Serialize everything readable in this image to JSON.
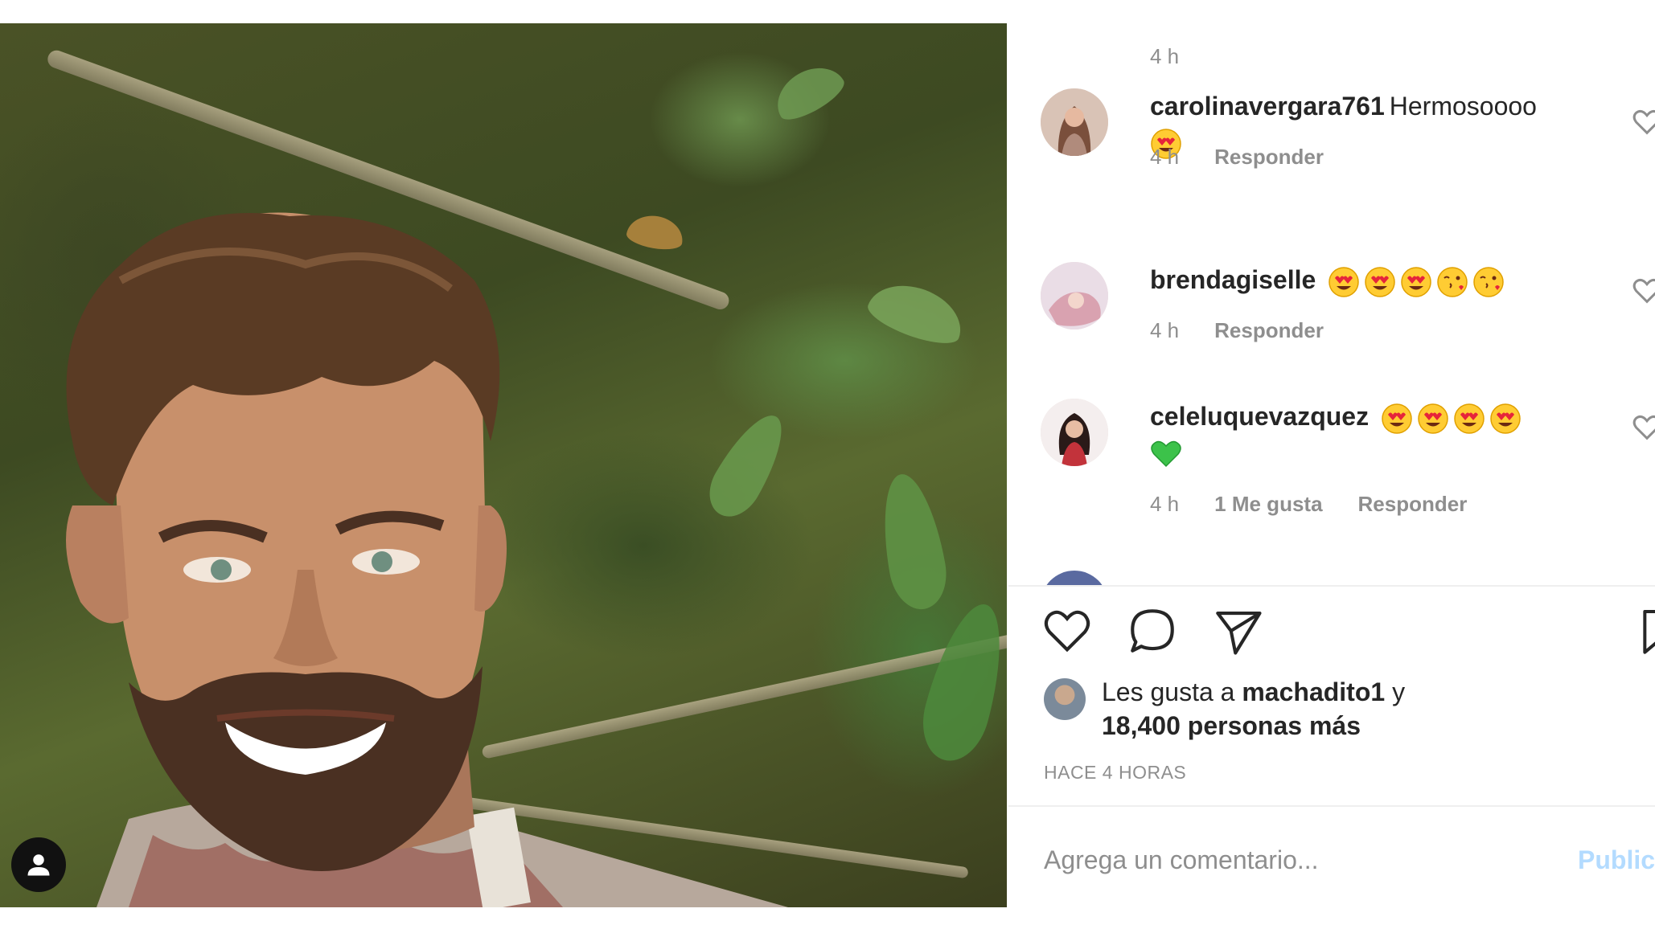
{
  "post": {
    "time_top": "4 h",
    "comments": [
      {
        "username": "carolinavergara761",
        "text": "Hermosoooo",
        "emojis": [
          "heart-eyes-emoji"
        ],
        "time": "4 h",
        "likes": "",
        "reply": "Responder"
      },
      {
        "username": "brendagiselle",
        "text": "",
        "emojis": [
          "heart-eyes-emoji",
          "heart-eyes-emoji",
          "heart-eyes-emoji",
          "kissing-emoji",
          "kissing-emoji"
        ],
        "time": "4 h",
        "likes": "",
        "reply": "Responder"
      },
      {
        "username": "celeluquevazquez",
        "text": "",
        "emojis": [
          "heart-eyes-emoji",
          "heart-eyes-emoji",
          "heart-eyes-emoji",
          "heart-eyes-emoji",
          "green-heart-emoji"
        ],
        "time": "4 h",
        "likes": "1 Me gusta",
        "reply": "Responder"
      }
    ],
    "actions": [
      "heart-icon",
      "comment-icon",
      "share-icon",
      "bookmark-icon"
    ],
    "likes_prefix": "Les gusta a",
    "likes_user": "machadito1",
    "likes_join": "y",
    "likes_count": "18,400 personas más",
    "timestamp": "HACE 4 HORAS",
    "comment_placeholder": "Agrega un comentario...",
    "publish_label": "Publicar",
    "colors": {
      "text": "#262626",
      "muted": "#8e8e8e",
      "publish": "#b3dbff",
      "divider": "#efefef"
    }
  }
}
